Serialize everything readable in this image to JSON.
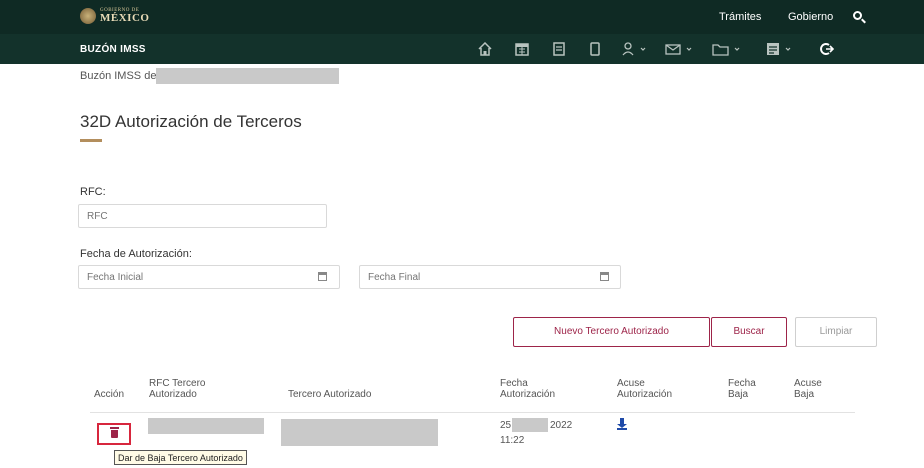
{
  "header": {
    "logo_small": "GOBIERNO DE",
    "logo_big": "MÉXICO",
    "links": [
      "Trámites",
      "Gobierno"
    ]
  },
  "subheader": {
    "title": "BUZÓN IMSS",
    "icons": [
      "home-icon",
      "calendar-icon",
      "document-icon",
      "mobile-icon",
      "user-menu-icon",
      "mail-menu-icon",
      "folder-menu-icon",
      "reports-menu-icon",
      "logout-icon"
    ]
  },
  "greeting": "Buzón IMSS de",
  "page_title": "32D Autorización de Terceros",
  "form": {
    "rfc_label": "RFC:",
    "rfc_placeholder": "RFC",
    "fecha_label": "Fecha de Autorización:",
    "fecha_inicial_placeholder": "Fecha Inicial",
    "fecha_final_placeholder": "Fecha Final"
  },
  "buttons": {
    "nuevo": "Nuevo Tercero Autorizado",
    "buscar": "Buscar",
    "limpiar": "Limpiar"
  },
  "table": {
    "columns": [
      "Acción",
      "RFC Tercero Autorizado",
      "Tercero Autorizado",
      "Fecha Autorización",
      "Acuse Autorización",
      "Fecha Baja",
      "Acuse Baja"
    ],
    "rows": [
      {
        "fecha_autorizacion_day": "25",
        "fecha_autorizacion_year": "2022",
        "fecha_autorizacion_time": "11:22"
      }
    ]
  },
  "tooltip": "Dar de Baja Tercero Autorizado",
  "colors": {
    "header_bg": "#0f2a24",
    "subheader_bg": "#13322b",
    "accent": "#9d2449",
    "gold": "#b38e5d",
    "highlight": "#d7263d",
    "download": "#1f4aa8"
  }
}
